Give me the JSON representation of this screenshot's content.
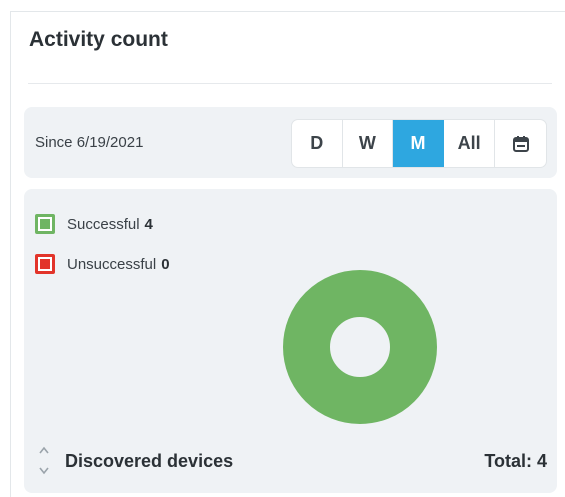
{
  "card": {
    "title": "Activity count"
  },
  "range": {
    "since_label": "Since 6/19/2021",
    "buttons": [
      {
        "label": "D",
        "active": false
      },
      {
        "label": "W",
        "active": false
      },
      {
        "label": "M",
        "active": true
      },
      {
        "label": "All",
        "active": false
      }
    ],
    "calendar_icon": "calendar-icon"
  },
  "legend": [
    {
      "label": "Successful",
      "count": "4",
      "color": "#6fb563"
    },
    {
      "label": "Unsuccessful",
      "count": "0",
      "color": "#e2342a"
    }
  ],
  "chart_data": {
    "type": "pie",
    "categories": [
      "Successful",
      "Unsuccessful"
    ],
    "values": [
      4,
      0
    ],
    "colors": [
      "#6fb563",
      "#e2342a"
    ],
    "title": "",
    "legend": "top-left"
  },
  "footer": {
    "label": "Discovered devices",
    "total": "Total: 4",
    "toggle_icon": "chevron-up-down-icon"
  },
  "colors": {
    "accent": "#2ea7e0",
    "panel_bg": "#eff2f5",
    "success": "#6fb563",
    "failure": "#e2342a"
  }
}
